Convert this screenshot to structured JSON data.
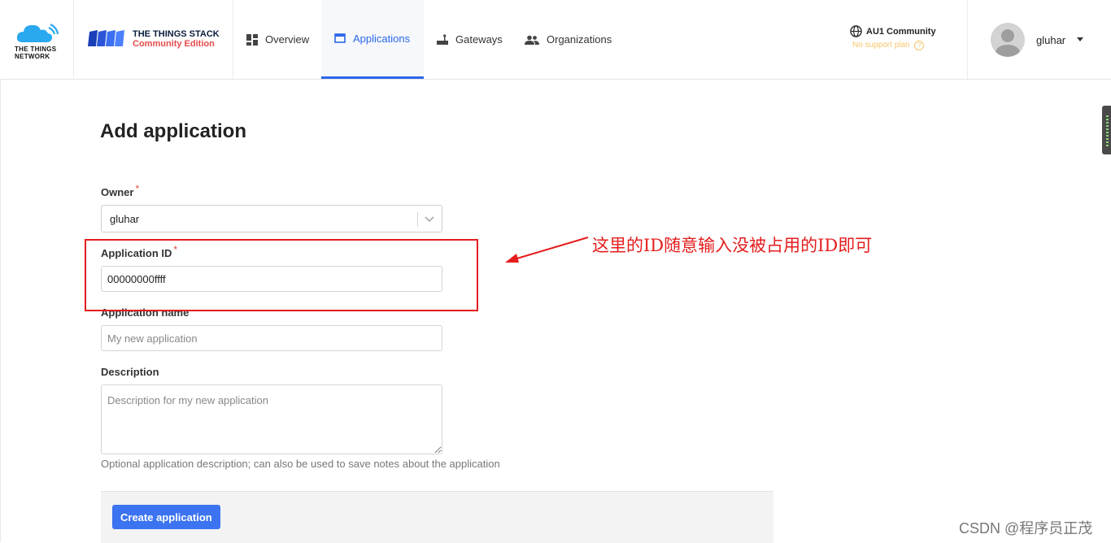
{
  "header": {
    "ttn_logo_text": [
      "THE THINGS",
      "NETWORK"
    ],
    "stack_title": "THE THINGS STACK",
    "stack_edition": "Community Edition",
    "nav": [
      {
        "label": "Overview",
        "icon": "dashboard-icon",
        "active": false
      },
      {
        "label": "Applications",
        "icon": "application-icon",
        "active": true
      },
      {
        "label": "Gateways",
        "icon": "gateway-icon",
        "active": false
      },
      {
        "label": "Organizations",
        "icon": "organization-icon",
        "active": false
      }
    ],
    "region": {
      "name": "AU1 Community",
      "plan": "No support plan",
      "icon": "globe-icon"
    },
    "user": {
      "name": "gluhar",
      "icon": "avatar-icon"
    }
  },
  "form": {
    "title": "Add application",
    "owner": {
      "label": "Owner",
      "required_mark": "*",
      "value": "gluhar"
    },
    "app_id": {
      "label": "Application ID",
      "required_mark": "*",
      "value": "00000000ffff"
    },
    "app_name": {
      "label": "Application name",
      "placeholder": "My new application"
    },
    "description": {
      "label": "Description",
      "placeholder": "Description for my new application",
      "help": "Optional application description; can also be used to save notes about the application"
    },
    "submit_label": "Create application"
  },
  "annotation": {
    "text": "这里的ID随意输入没被占用的ID即可",
    "color": "#e51d1d"
  },
  "watermark": "CSDN @程序员正茂",
  "colors": {
    "accent": "#2b67e8",
    "button": "#3b73f0",
    "annotation": "#e51d1d"
  }
}
